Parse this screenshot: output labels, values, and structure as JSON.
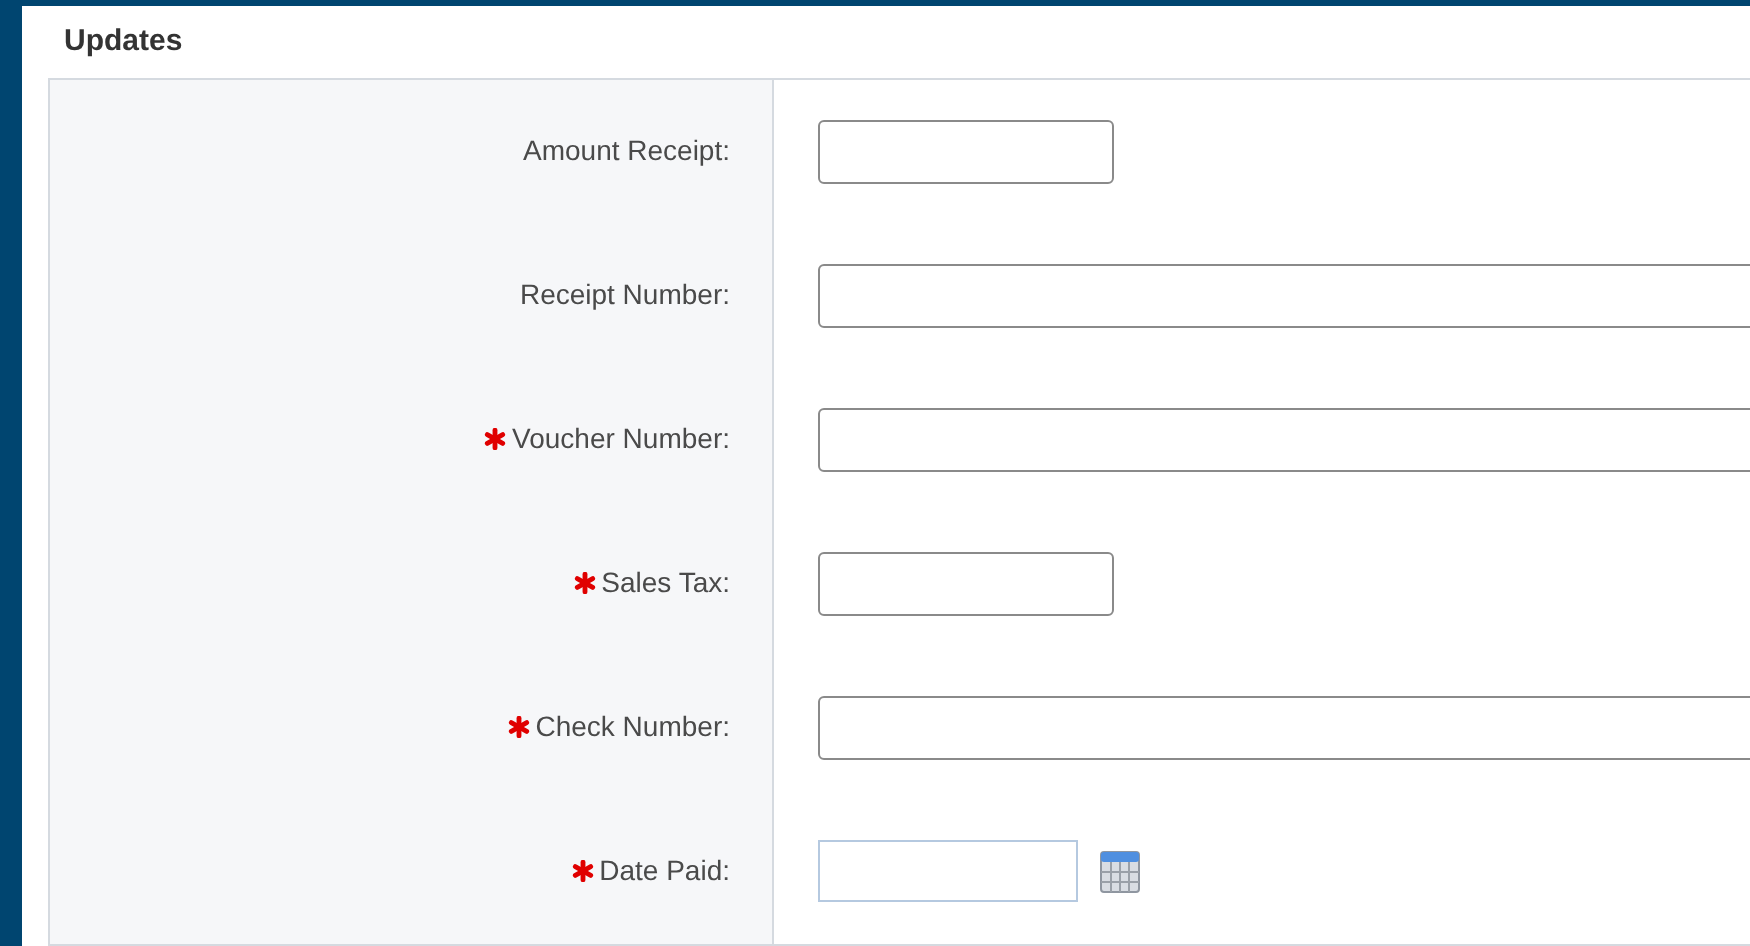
{
  "section": {
    "title": "Updates"
  },
  "fields": [
    {
      "label": "Amount Receipt:",
      "required": false,
      "kind": "short"
    },
    {
      "label": "Receipt Number:",
      "required": false,
      "kind": "long"
    },
    {
      "label": "Voucher Number:",
      "required": true,
      "kind": "long"
    },
    {
      "label": "Sales Tax:",
      "required": true,
      "kind": "short"
    },
    {
      "label": "Check Number:",
      "required": true,
      "kind": "long"
    },
    {
      "label": "Date Paid:",
      "required": true,
      "kind": "date"
    }
  ]
}
